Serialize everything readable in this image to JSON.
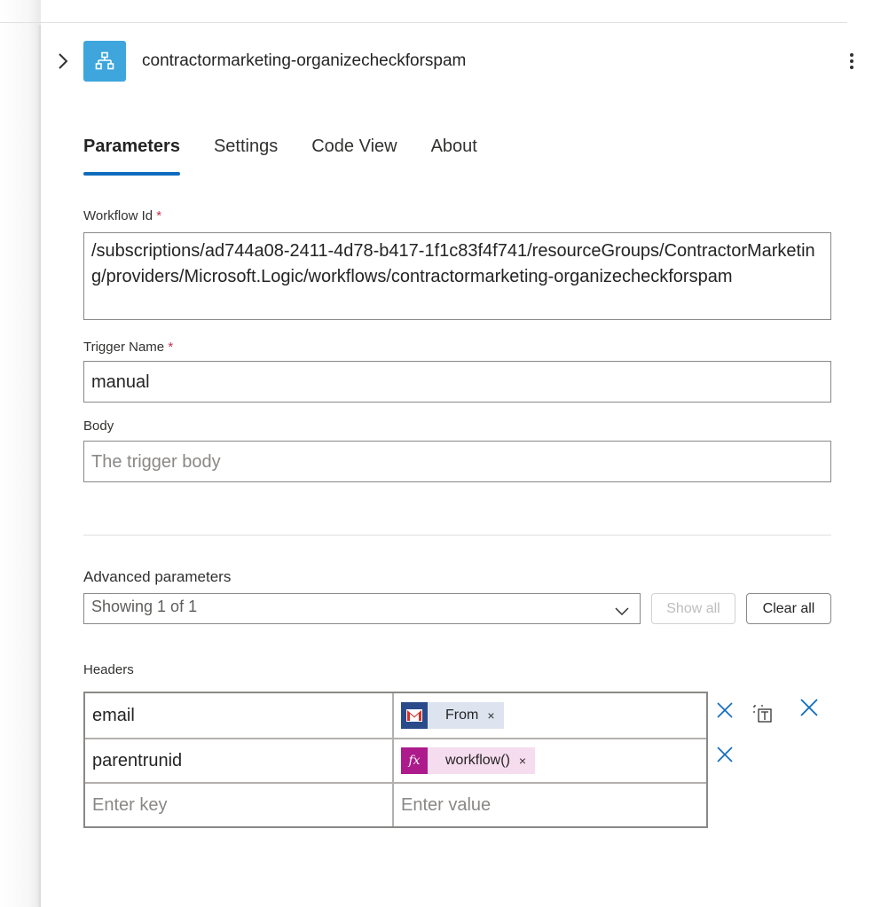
{
  "header": {
    "title": "contractormarketing-organizecheckforspam"
  },
  "tabs": [
    {
      "label": "Parameters",
      "active": true
    },
    {
      "label": "Settings"
    },
    {
      "label": "Code View"
    },
    {
      "label": "About"
    }
  ],
  "fields": {
    "workflow_id": {
      "label": "Workflow Id",
      "required_mark": "*",
      "value": "/subscriptions/ad744a08-2411-4d78-b417-1f1c83f4f741/resourceGroups/ContractorMarketing/providers/Microsoft.Logic/workflows/contractormarketing-organizecheckforspam"
    },
    "trigger_name": {
      "label": "Trigger Name",
      "required_mark": "*",
      "value": "manual"
    },
    "body": {
      "label": "Body",
      "placeholder": "The trigger body"
    }
  },
  "advanced": {
    "label": "Advanced parameters",
    "dropdown_value": "Showing 1 of 1",
    "show_all": "Show all",
    "clear_all": "Clear all"
  },
  "headers": {
    "label": "Headers",
    "rows": [
      {
        "key": "email",
        "token_label": "From",
        "token_icon": "gmail-icon",
        "token_remove": "×"
      },
      {
        "key": "parentrunid",
        "token_label": "workflow()",
        "token_icon": "function-icon",
        "token_glyph": "fx",
        "token_remove": "×"
      }
    ],
    "key_placeholder": "Enter key",
    "value_placeholder": "Enter value"
  },
  "colors": {
    "accent": "#0f6cbd",
    "node_icon_bg": "#3ea6dc",
    "gmail_token": "#2b4a8a",
    "function_token": "#ad1a8b"
  }
}
